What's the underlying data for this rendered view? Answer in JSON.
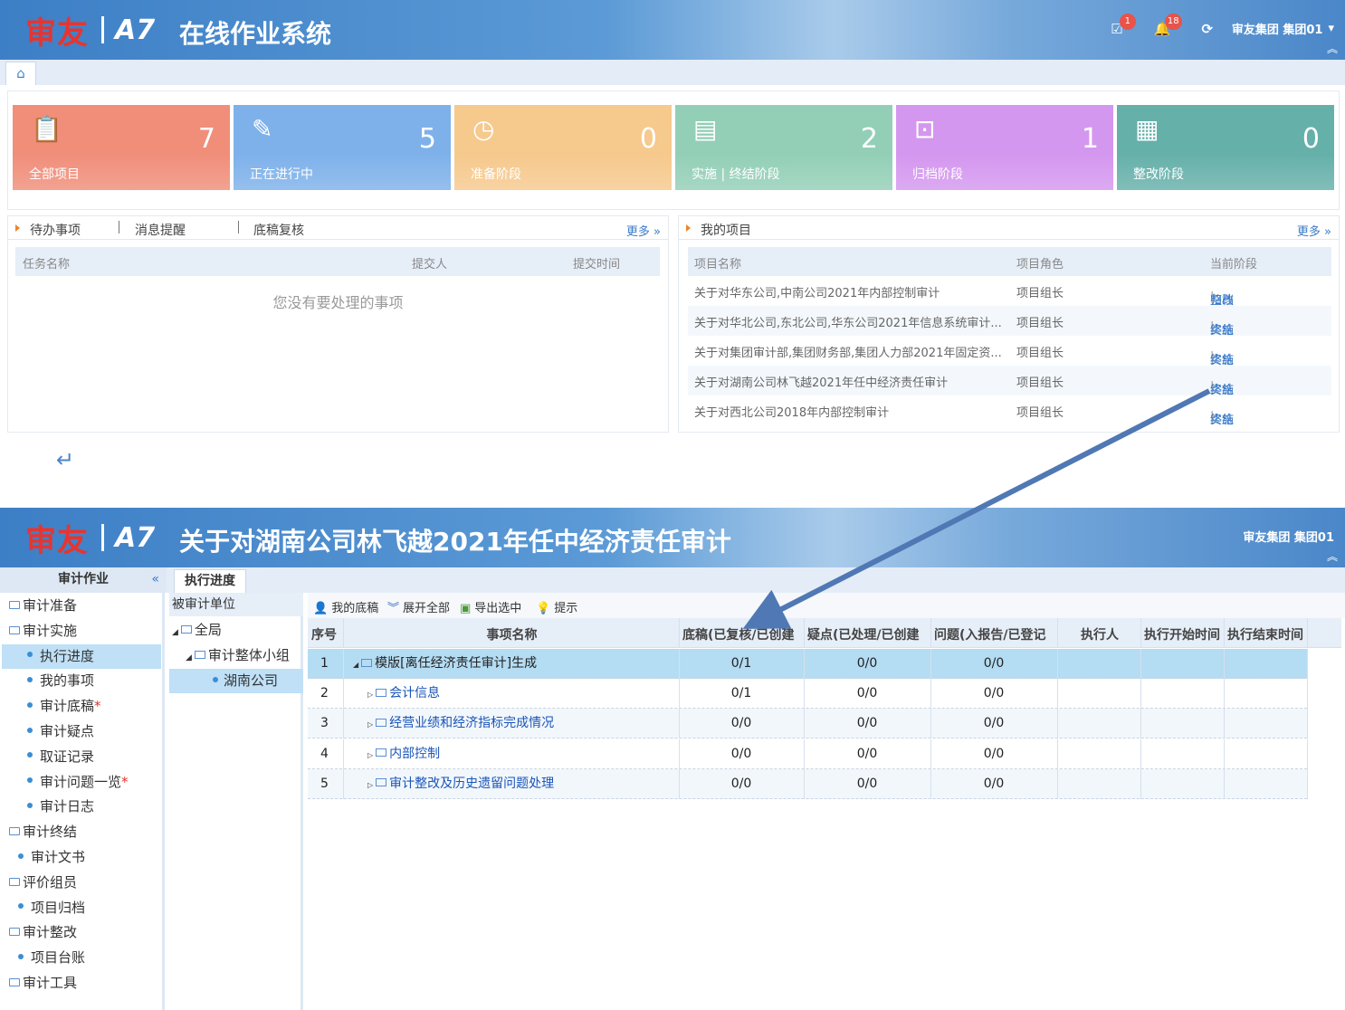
{
  "screen1": {
    "logo": {
      "brand": "审友",
      "version": "A7"
    },
    "title": "在线作业系统",
    "header": {
      "task_badge": "1",
      "bell_badge": "18",
      "user": "审友集团 集团01"
    },
    "cards": [
      {
        "label": "全部项目",
        "count": "7",
        "color": "#f08e7a",
        "icon": "clipboard-icon",
        "glyph": "📋"
      },
      {
        "label": "正在进行中",
        "count": "5",
        "color": "#7eb1ea",
        "icon": "edit-icon",
        "glyph": "✎"
      },
      {
        "label": "准备阶段",
        "count": "0",
        "color": "#f6c98d",
        "icon": "clock-icon",
        "glyph": "◷"
      },
      {
        "label": "实施 | 终结阶段",
        "count": "2",
        "color": "#93cfb7",
        "icon": "document-edit-icon",
        "glyph": "▤"
      },
      {
        "label": "归档阶段",
        "count": "1",
        "color": "#d497ef",
        "icon": "archive-icon",
        "glyph": "⊡"
      },
      {
        "label": "整改阶段",
        "count": "0",
        "color": "#66b0aa",
        "icon": "document-search-icon",
        "glyph": "▦"
      }
    ],
    "todo_panel": {
      "tabs": [
        "待办事项",
        "消息提醒",
        "底稿复核"
      ],
      "more": "更多 »",
      "columns": [
        "任务名称",
        "提交人",
        "提交时间"
      ],
      "empty": "您没有要处理的事项"
    },
    "projects_panel": {
      "title": "我的项目",
      "more": "更多 »",
      "columns": [
        "项目名称",
        "项目角色",
        "当前阶段"
      ],
      "rows": [
        {
          "name": "关于对华东公司,中南公司2021年内部控制审计",
          "role": "项目组长",
          "stage_a": "归档",
          "stage_b": "整改"
        },
        {
          "name": "关于对华北公司,东北公司,华东公司2021年信息系统审计...",
          "role": "项目组长",
          "stage_a": "实施",
          "stage_b": "终结"
        },
        {
          "name": "关于对集团审计部,集团财务部,集团人力部2021年固定资...",
          "role": "项目组长",
          "stage_a": "实施",
          "stage_b": "终结"
        },
        {
          "name": "关于对湖南公司林飞越2021年任中经济责任审计",
          "role": "项目组长",
          "stage_a": "实施",
          "stage_b": "终结"
        },
        {
          "name": "关于对西北公司2018年内部控制审计",
          "role": "项目组长",
          "stage_a": "实施",
          "stage_b": "终结"
        }
      ],
      "separator": "|"
    }
  },
  "screen2": {
    "title": "关于对湖南公司林飞越2021年任中经济责任审计",
    "user": "审友集团 集团01",
    "side_header": "审计作业",
    "side_collapse": "«",
    "active_tab": "执行进度",
    "sidebar": [
      {
        "label": "审计准备",
        "kind": "folder"
      },
      {
        "label": "审计实施",
        "kind": "folder"
      },
      {
        "label": "执行进度",
        "kind": "leaf",
        "selected": true
      },
      {
        "label": "我的事项",
        "kind": "leaf"
      },
      {
        "label": "审计底稿",
        "kind": "leaf",
        "star": "*"
      },
      {
        "label": "审计疑点",
        "kind": "leaf"
      },
      {
        "label": "取证记录",
        "kind": "leaf"
      },
      {
        "label": "审计问题一览",
        "kind": "leaf",
        "star": "*"
      },
      {
        "label": "审计日志",
        "kind": "leaf"
      },
      {
        "label": "审计终结",
        "kind": "folder"
      },
      {
        "label": "审计文书",
        "kind": "leaf2"
      },
      {
        "label": "评价组员",
        "kind": "folder"
      },
      {
        "label": "项目归档",
        "kind": "leaf2"
      },
      {
        "label": "审计整改",
        "kind": "folder"
      },
      {
        "label": "项目台账",
        "kind": "leaf2"
      },
      {
        "label": "审计工具",
        "kind": "folder"
      }
    ],
    "tree": {
      "header": "被审计单位",
      "nodes": [
        "全局",
        "审计整体小组",
        "湖南公司"
      ]
    },
    "toolbar": [
      "我的底稿",
      "展开全部",
      "导出选中",
      "提示"
    ],
    "grid": {
      "columns": [
        "序号",
        "事项名称",
        "底稿(已复核/已创建",
        "疑点(已处理/已创建",
        "问题(入报告/已登记",
        "执行人",
        "执行开始时间",
        "执行结束时间"
      ],
      "rows": [
        {
          "no": "1",
          "name": "模版[离任经济责任审计]生成",
          "draft": "0/1",
          "doubt": "0/0",
          "issue": "0/0"
        },
        {
          "no": "2",
          "name": "会计信息",
          "draft": "0/1",
          "doubt": "0/0",
          "issue": "0/0"
        },
        {
          "no": "3",
          "name": "经营业绩和经济指标完成情况",
          "draft": "0/0",
          "doubt": "0/0",
          "issue": "0/0"
        },
        {
          "no": "4",
          "name": "内部控制",
          "draft": "0/0",
          "doubt": "0/0",
          "issue": "0/0"
        },
        {
          "no": "5",
          "name": "审计整改及历史遗留问题处理",
          "draft": "0/0",
          "doubt": "0/0",
          "issue": "0/0"
        }
      ]
    }
  }
}
